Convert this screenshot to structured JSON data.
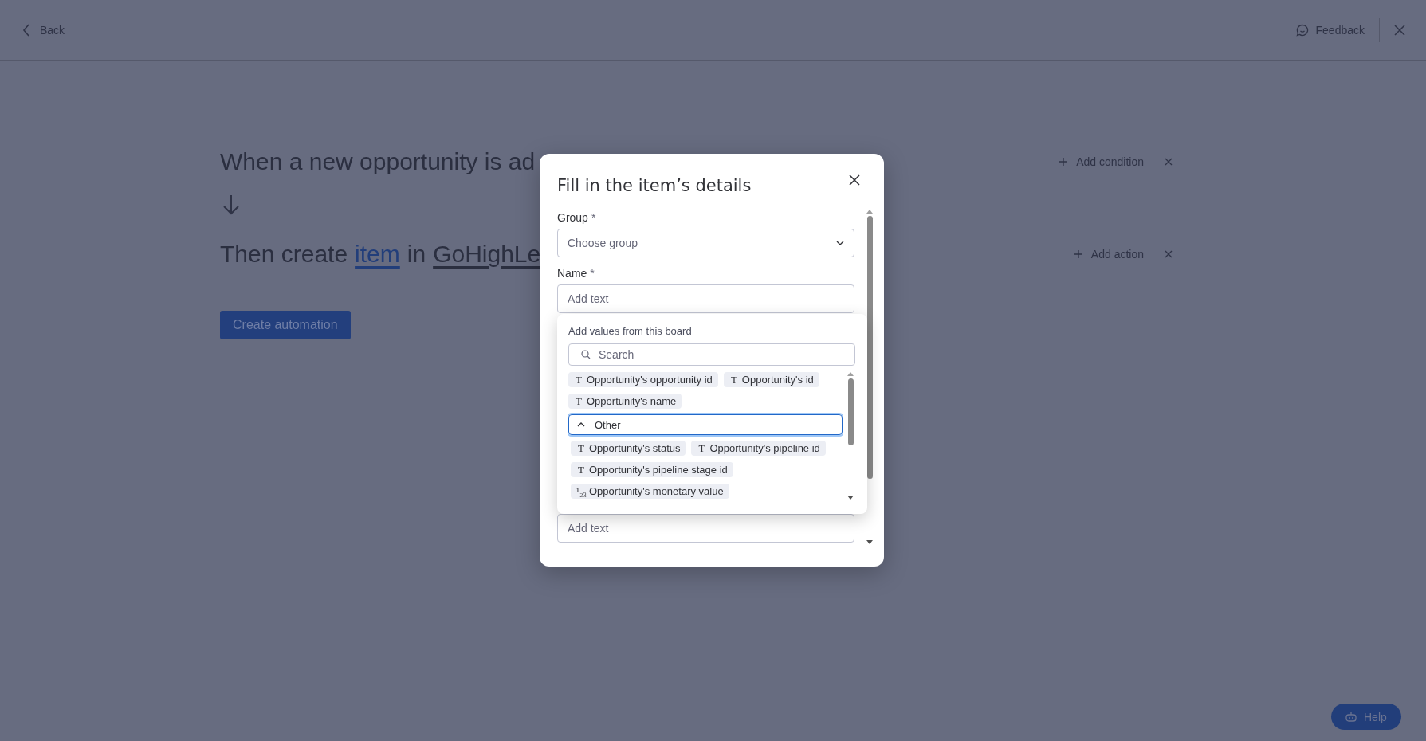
{
  "top_bar": {
    "back": "Back",
    "feedback": "Feedback"
  },
  "automation": {
    "trigger": "When a new opportunity is ad",
    "action": {
      "prefix": "Then create",
      "item": "item",
      "joiner": "in",
      "board": "GoHighLe"
    },
    "side_actions": [
      {
        "label": "Add condition"
      },
      {
        "label": "Add action"
      }
    ],
    "button": "Create automation"
  },
  "dialog": {
    "title": "Fill in the item’s details",
    "fields": [
      {
        "kind": "select",
        "label": "Group",
        "required_mark": "*",
        "placeholder": "Choose group"
      },
      {
        "kind": "text",
        "label": "Name",
        "required_mark": "*",
        "placeholder": "Add text"
      }
    ],
    "values_popup": {
      "title": "Add values from this board",
      "search_placeholder": "Search",
      "chips": [
        {
          "icon": "T",
          "label": "Opportunity's opportunity id"
        },
        {
          "icon": "T",
          "label": "Opportunity's id"
        },
        {
          "icon": "T",
          "label": "Opportunity's name"
        }
      ],
      "groups": [
        {
          "label": "Other",
          "expanded": true,
          "selected": true,
          "chips": [
            {
              "icon": "T",
              "label": "Opportunity's status"
            },
            {
              "icon": "T",
              "label": "Opportunity's pipeline id"
            },
            {
              "icon": "T",
              "label": "Opportunity's pipeline stage id"
            },
            {
              "icon": "¹₂₃",
              "label": "Opportunity's monetary value"
            }
          ]
        }
      ]
    },
    "bottom_field": {
      "placeholder": "Add text"
    }
  },
  "help": "Help"
}
